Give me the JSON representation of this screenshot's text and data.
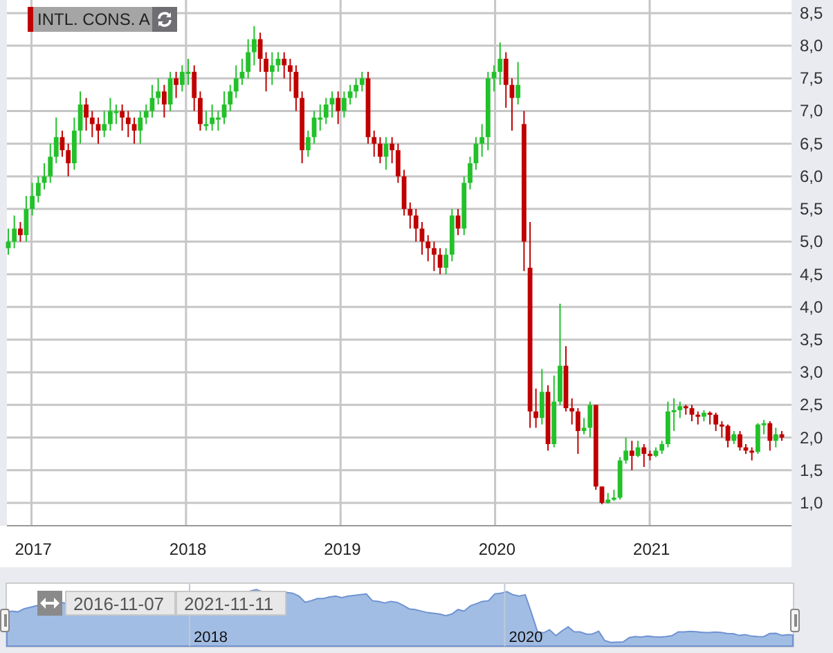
{
  "instrument_tag": {
    "label": "INTL. CONS. A"
  },
  "chart": {
    "chart_data": {
      "type": "candlestick",
      "grid": true,
      "xlim": [
        2016.811,
        2021.894
      ],
      "ylim": [
        0.65,
        8.7
      ],
      "xticks": [
        {
          "value": 2017,
          "label": "2017"
        },
        {
          "value": 2018,
          "label": "2018"
        },
        {
          "value": 2019,
          "label": "2019"
        },
        {
          "value": 2020,
          "label": "2020"
        },
        {
          "value": 2021,
          "label": "2021"
        }
      ],
      "yticks": [
        {
          "value": 1.0,
          "label": "1,0"
        },
        {
          "value": 1.5,
          "label": "1,5"
        },
        {
          "value": 2.0,
          "label": "2,0"
        },
        {
          "value": 2.5,
          "label": "2,5"
        },
        {
          "value": 3.0,
          "label": "3,0"
        },
        {
          "value": 3.5,
          "label": "3,5"
        },
        {
          "value": 4.0,
          "label": "4,0"
        },
        {
          "value": 4.5,
          "label": "4,5"
        },
        {
          "value": 5.0,
          "label": "5,0"
        },
        {
          "value": 5.5,
          "label": "5,5"
        },
        {
          "value": 6.0,
          "label": "6,0"
        },
        {
          "value": 6.5,
          "label": "6,5"
        },
        {
          "value": 7.0,
          "label": "7,0"
        },
        {
          "value": 7.5,
          "label": "7,5"
        },
        {
          "value": 8.0,
          "label": "8,0"
        },
        {
          "value": 8.5,
          "label": "8,5"
        }
      ],
      "x": [
        2016.85,
        2016.889,
        2016.928,
        2016.966,
        2017.005,
        2017.044,
        2017.083,
        2017.122,
        2017.16,
        2017.199,
        2017.238,
        2017.277,
        2017.316,
        2017.354,
        2017.393,
        2017.432,
        2017.471,
        2017.51,
        2017.548,
        2017.587,
        2017.626,
        2017.665,
        2017.704,
        2017.742,
        2017.781,
        2017.82,
        2017.859,
        2017.898,
        2017.936,
        2017.975,
        2018.014,
        2018.053,
        2018.092,
        2018.13,
        2018.169,
        2018.208,
        2018.247,
        2018.286,
        2018.324,
        2018.363,
        2018.402,
        2018.441,
        2018.48,
        2018.518,
        2018.557,
        2018.596,
        2018.635,
        2018.674,
        2018.712,
        2018.751,
        2018.79,
        2018.829,
        2018.868,
        2018.906,
        2018.945,
        2018.984,
        2019.023,
        2019.062,
        2019.1,
        2019.139,
        2019.178,
        2019.217,
        2019.256,
        2019.294,
        2019.333,
        2019.372,
        2019.411,
        2019.45,
        2019.488,
        2019.527,
        2019.566,
        2019.605,
        2019.644,
        2019.682,
        2019.721,
        2019.76,
        2019.799,
        2019.838,
        2019.876,
        2019.915,
        2019.954,
        2019.993,
        2020.032,
        2020.07,
        2020.109,
        2020.148,
        2020.187,
        2020.226,
        2020.264,
        2020.303,
        2020.342,
        2020.381,
        2020.42,
        2020.458,
        2020.497,
        2020.536,
        2020.575,
        2020.614,
        2020.652,
        2020.691,
        2020.73,
        2020.769,
        2020.808,
        2020.846,
        2020.885,
        2020.924,
        2020.963,
        2021.002,
        2021.04,
        2021.079,
        2021.118,
        2021.157,
        2021.196,
        2021.234,
        2021.273,
        2021.312,
        2021.351,
        2021.39,
        2021.428,
        2021.467,
        2021.506,
        2021.545,
        2021.584,
        2021.622,
        2021.661,
        2021.7,
        2021.739,
        2021.778,
        2021.816,
        2021.855
      ],
      "ohlc": [
        [
          4.9,
          5.2,
          4.8,
          5.0
        ],
        [
          5.0,
          5.4,
          4.9,
          5.2
        ],
        [
          5.2,
          5.3,
          5.0,
          5.1
        ],
        [
          5.1,
          5.7,
          5.0,
          5.5
        ],
        [
          5.5,
          5.9,
          5.4,
          5.7
        ],
        [
          5.7,
          6.0,
          5.6,
          5.9
        ],
        [
          5.9,
          6.2,
          5.8,
          6.0
        ],
        [
          6.0,
          6.5,
          5.9,
          6.3
        ],
        [
          6.3,
          6.9,
          6.2,
          6.6
        ],
        [
          6.6,
          6.7,
          6.3,
          6.4
        ],
        [
          6.4,
          6.5,
          6.0,
          6.2
        ],
        [
          6.2,
          6.9,
          6.1,
          6.7
        ],
        [
          6.7,
          7.3,
          6.5,
          7.1
        ],
        [
          7.1,
          7.2,
          6.7,
          6.9
        ],
        [
          6.9,
          7.0,
          6.6,
          6.8
        ],
        [
          6.8,
          6.9,
          6.5,
          6.7
        ],
        [
          6.7,
          7.0,
          6.6,
          6.8
        ],
        [
          6.8,
          7.2,
          6.7,
          7.0
        ],
        [
          7.0,
          7.1,
          6.8,
          7.0
        ],
        [
          7.0,
          7.1,
          6.7,
          6.9
        ],
        [
          6.9,
          7.0,
          6.6,
          6.8
        ],
        [
          6.8,
          6.9,
          6.5,
          6.7
        ],
        [
          6.7,
          7.0,
          6.5,
          6.9
        ],
        [
          6.9,
          7.1,
          6.8,
          7.0
        ],
        [
          7.0,
          7.4,
          6.9,
          7.2
        ],
        [
          7.2,
          7.5,
          7.1,
          7.3
        ],
        [
          7.3,
          7.4,
          6.9,
          7.1
        ],
        [
          7.1,
          7.6,
          7.0,
          7.5
        ],
        [
          7.5,
          7.6,
          7.2,
          7.4
        ],
        [
          7.4,
          7.7,
          7.3,
          7.6
        ],
        [
          7.6,
          7.8,
          7.4,
          7.6
        ],
        [
          7.6,
          7.7,
          7.0,
          7.2
        ],
        [
          7.2,
          7.3,
          6.7,
          6.8
        ],
        [
          6.8,
          7.0,
          6.7,
          6.8
        ],
        [
          6.8,
          7.1,
          6.7,
          6.9
        ],
        [
          6.9,
          7.0,
          6.7,
          6.9
        ],
        [
          6.9,
          7.3,
          6.8,
          7.1
        ],
        [
          7.1,
          7.4,
          7.0,
          7.3
        ],
        [
          7.3,
          7.7,
          7.2,
          7.5
        ],
        [
          7.5,
          7.8,
          7.4,
          7.6
        ],
        [
          7.6,
          8.1,
          7.5,
          7.9
        ],
        [
          7.9,
          8.3,
          7.7,
          8.1
        ],
        [
          8.1,
          8.2,
          7.6,
          7.8
        ],
        [
          7.8,
          7.9,
          7.3,
          7.6
        ],
        [
          7.6,
          7.9,
          7.4,
          7.7
        ],
        [
          7.7,
          7.9,
          7.6,
          7.8
        ],
        [
          7.8,
          7.9,
          7.5,
          7.7
        ],
        [
          7.7,
          7.8,
          7.3,
          7.6
        ],
        [
          7.6,
          7.7,
          7.0,
          7.2
        ],
        [
          7.2,
          7.3,
          6.2,
          6.4
        ],
        [
          6.4,
          6.7,
          6.3,
          6.6
        ],
        [
          6.6,
          7.0,
          6.5,
          6.9
        ],
        [
          6.9,
          7.1,
          6.7,
          6.9
        ],
        [
          6.9,
          7.2,
          6.8,
          7.1
        ],
        [
          7.1,
          7.3,
          6.9,
          7.2
        ],
        [
          7.2,
          7.3,
          6.8,
          7.0
        ],
        [
          7.0,
          7.3,
          6.9,
          7.2
        ],
        [
          7.2,
          7.4,
          7.1,
          7.3
        ],
        [
          7.3,
          7.5,
          7.2,
          7.4
        ],
        [
          7.4,
          7.6,
          7.3,
          7.5
        ],
        [
          7.5,
          7.6,
          6.5,
          6.6
        ],
        [
          6.6,
          6.7,
          6.3,
          6.5
        ],
        [
          6.5,
          6.6,
          6.2,
          6.3
        ],
        [
          6.3,
          6.6,
          6.1,
          6.5
        ],
        [
          6.5,
          6.6,
          6.2,
          6.4
        ],
        [
          6.4,
          6.5,
          5.9,
          6.0
        ],
        [
          6.0,
          6.1,
          5.4,
          5.5
        ],
        [
          5.5,
          5.6,
          5.2,
          5.4
        ],
        [
          5.4,
          5.5,
          5.0,
          5.2
        ],
        [
          5.2,
          5.3,
          4.8,
          5.0
        ],
        [
          5.0,
          5.1,
          4.7,
          4.9
        ],
        [
          4.9,
          5.0,
          4.55,
          4.8
        ],
        [
          4.8,
          4.9,
          4.5,
          4.6
        ],
        [
          4.6,
          4.9,
          4.5,
          4.8
        ],
        [
          4.8,
          5.5,
          4.7,
          5.4
        ],
        [
          5.4,
          5.5,
          5.1,
          5.2
        ],
        [
          5.2,
          6.0,
          5.1,
          5.9
        ],
        [
          5.9,
          6.3,
          5.8,
          6.2
        ],
        [
          6.2,
          6.6,
          6.1,
          6.5
        ],
        [
          6.5,
          6.8,
          6.3,
          6.6
        ],
        [
          6.6,
          7.6,
          6.4,
          7.5
        ],
        [
          7.5,
          7.7,
          7.3,
          7.6
        ],
        [
          7.6,
          8.05,
          7.4,
          7.8
        ],
        [
          7.8,
          7.9,
          7.05,
          7.4
        ],
        [
          7.4,
          7.5,
          6.7,
          7.2
        ],
        [
          7.2,
          7.75,
          7.1,
          7.4
        ],
        [
          6.8,
          7.0,
          4.55,
          5.0
        ],
        [
          4.6,
          5.3,
          2.15,
          2.4
        ],
        [
          2.4,
          2.75,
          2.15,
          2.3
        ],
        [
          2.3,
          3.05,
          2.2,
          2.7
        ],
        [
          2.7,
          2.8,
          1.8,
          1.9
        ],
        [
          1.9,
          2.95,
          1.85,
          2.55
        ],
        [
          2.55,
          4.05,
          2.5,
          3.1
        ],
        [
          3.1,
          3.4,
          2.4,
          2.45
        ],
        [
          2.45,
          2.6,
          2.2,
          2.4
        ],
        [
          2.4,
          2.45,
          1.75,
          2.1
        ],
        [
          2.1,
          2.3,
          2.05,
          2.15
        ],
        [
          2.15,
          2.55,
          2.0,
          2.5
        ],
        [
          2.5,
          2.5,
          1.2,
          1.25
        ],
        [
          1.25,
          1.25,
          0.98,
          1.0
        ],
        [
          1.0,
          1.15,
          0.99,
          1.05
        ],
        [
          1.05,
          1.2,
          1.03,
          1.08
        ],
        [
          1.08,
          1.7,
          1.05,
          1.65
        ],
        [
          1.65,
          2.0,
          1.6,
          1.8
        ],
        [
          1.8,
          1.95,
          1.5,
          1.72
        ],
        [
          1.72,
          1.95,
          1.7,
          1.85
        ],
        [
          1.85,
          1.9,
          1.55,
          1.75
        ],
        [
          1.75,
          1.8,
          1.65,
          1.72
        ],
        [
          1.72,
          1.85,
          1.7,
          1.8
        ],
        [
          1.8,
          1.95,
          1.75,
          1.9
        ],
        [
          1.9,
          2.55,
          1.85,
          2.4
        ],
        [
          2.4,
          2.6,
          2.1,
          2.42
        ],
        [
          2.42,
          2.55,
          2.3,
          2.48
        ],
        [
          2.48,
          2.5,
          2.35,
          2.45
        ],
        [
          2.45,
          2.5,
          2.25,
          2.35
        ],
        [
          2.35,
          2.4,
          2.2,
          2.32
        ],
        [
          2.32,
          2.42,
          2.25,
          2.38
        ],
        [
          2.38,
          2.4,
          2.2,
          2.35
        ],
        [
          2.35,
          2.38,
          2.1,
          2.2
        ],
        [
          2.2,
          2.25,
          2.0,
          2.18
        ],
        [
          2.18,
          2.2,
          1.85,
          1.95
        ],
        [
          1.95,
          2.1,
          1.9,
          2.05
        ],
        [
          2.05,
          2.1,
          1.8,
          1.85
        ],
        [
          1.85,
          1.9,
          1.75,
          1.8
        ],
        [
          1.8,
          1.85,
          1.65,
          1.78
        ],
        [
          1.78,
          2.22,
          1.75,
          2.2
        ],
        [
          2.2,
          2.27,
          2.05,
          2.22
        ],
        [
          2.22,
          2.25,
          1.8,
          1.95
        ],
        [
          1.95,
          2.15,
          1.85,
          2.05
        ],
        [
          2.05,
          2.1,
          1.95,
          2.0
        ]
      ]
    }
  },
  "navigator": {
    "start_date": "2016-11-07",
    "end_date": "2021-11-11",
    "tick_labels": [
      "2018",
      "2020"
    ]
  }
}
